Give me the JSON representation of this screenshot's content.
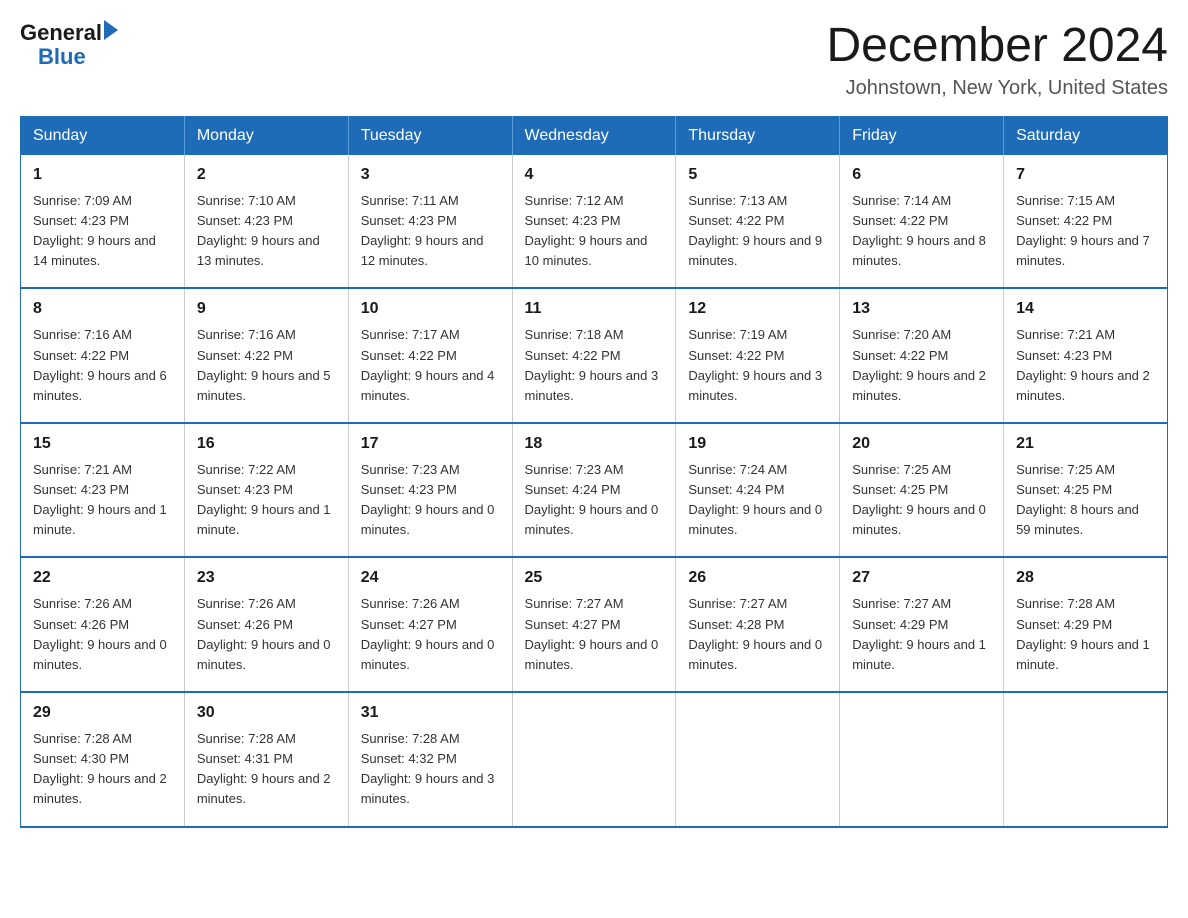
{
  "logo": {
    "general": "General",
    "blue": "Blue"
  },
  "title": "December 2024",
  "location": "Johnstown, New York, United States",
  "weekdays": [
    "Sunday",
    "Monday",
    "Tuesday",
    "Wednesday",
    "Thursday",
    "Friday",
    "Saturday"
  ],
  "weeks": [
    [
      {
        "day": "1",
        "sunrise": "Sunrise: 7:09 AM",
        "sunset": "Sunset: 4:23 PM",
        "daylight": "Daylight: 9 hours and 14 minutes."
      },
      {
        "day": "2",
        "sunrise": "Sunrise: 7:10 AM",
        "sunset": "Sunset: 4:23 PM",
        "daylight": "Daylight: 9 hours and 13 minutes."
      },
      {
        "day": "3",
        "sunrise": "Sunrise: 7:11 AM",
        "sunset": "Sunset: 4:23 PM",
        "daylight": "Daylight: 9 hours and 12 minutes."
      },
      {
        "day": "4",
        "sunrise": "Sunrise: 7:12 AM",
        "sunset": "Sunset: 4:23 PM",
        "daylight": "Daylight: 9 hours and 10 minutes."
      },
      {
        "day": "5",
        "sunrise": "Sunrise: 7:13 AM",
        "sunset": "Sunset: 4:22 PM",
        "daylight": "Daylight: 9 hours and 9 minutes."
      },
      {
        "day": "6",
        "sunrise": "Sunrise: 7:14 AM",
        "sunset": "Sunset: 4:22 PM",
        "daylight": "Daylight: 9 hours and 8 minutes."
      },
      {
        "day": "7",
        "sunrise": "Sunrise: 7:15 AM",
        "sunset": "Sunset: 4:22 PM",
        "daylight": "Daylight: 9 hours and 7 minutes."
      }
    ],
    [
      {
        "day": "8",
        "sunrise": "Sunrise: 7:16 AM",
        "sunset": "Sunset: 4:22 PM",
        "daylight": "Daylight: 9 hours and 6 minutes."
      },
      {
        "day": "9",
        "sunrise": "Sunrise: 7:16 AM",
        "sunset": "Sunset: 4:22 PM",
        "daylight": "Daylight: 9 hours and 5 minutes."
      },
      {
        "day": "10",
        "sunrise": "Sunrise: 7:17 AM",
        "sunset": "Sunset: 4:22 PM",
        "daylight": "Daylight: 9 hours and 4 minutes."
      },
      {
        "day": "11",
        "sunrise": "Sunrise: 7:18 AM",
        "sunset": "Sunset: 4:22 PM",
        "daylight": "Daylight: 9 hours and 3 minutes."
      },
      {
        "day": "12",
        "sunrise": "Sunrise: 7:19 AM",
        "sunset": "Sunset: 4:22 PM",
        "daylight": "Daylight: 9 hours and 3 minutes."
      },
      {
        "day": "13",
        "sunrise": "Sunrise: 7:20 AM",
        "sunset": "Sunset: 4:22 PM",
        "daylight": "Daylight: 9 hours and 2 minutes."
      },
      {
        "day": "14",
        "sunrise": "Sunrise: 7:21 AM",
        "sunset": "Sunset: 4:23 PM",
        "daylight": "Daylight: 9 hours and 2 minutes."
      }
    ],
    [
      {
        "day": "15",
        "sunrise": "Sunrise: 7:21 AM",
        "sunset": "Sunset: 4:23 PM",
        "daylight": "Daylight: 9 hours and 1 minute."
      },
      {
        "day": "16",
        "sunrise": "Sunrise: 7:22 AM",
        "sunset": "Sunset: 4:23 PM",
        "daylight": "Daylight: 9 hours and 1 minute."
      },
      {
        "day": "17",
        "sunrise": "Sunrise: 7:23 AM",
        "sunset": "Sunset: 4:23 PM",
        "daylight": "Daylight: 9 hours and 0 minutes."
      },
      {
        "day": "18",
        "sunrise": "Sunrise: 7:23 AM",
        "sunset": "Sunset: 4:24 PM",
        "daylight": "Daylight: 9 hours and 0 minutes."
      },
      {
        "day": "19",
        "sunrise": "Sunrise: 7:24 AM",
        "sunset": "Sunset: 4:24 PM",
        "daylight": "Daylight: 9 hours and 0 minutes."
      },
      {
        "day": "20",
        "sunrise": "Sunrise: 7:25 AM",
        "sunset": "Sunset: 4:25 PM",
        "daylight": "Daylight: 9 hours and 0 minutes."
      },
      {
        "day": "21",
        "sunrise": "Sunrise: 7:25 AM",
        "sunset": "Sunset: 4:25 PM",
        "daylight": "Daylight: 8 hours and 59 minutes."
      }
    ],
    [
      {
        "day": "22",
        "sunrise": "Sunrise: 7:26 AM",
        "sunset": "Sunset: 4:26 PM",
        "daylight": "Daylight: 9 hours and 0 minutes."
      },
      {
        "day": "23",
        "sunrise": "Sunrise: 7:26 AM",
        "sunset": "Sunset: 4:26 PM",
        "daylight": "Daylight: 9 hours and 0 minutes."
      },
      {
        "day": "24",
        "sunrise": "Sunrise: 7:26 AM",
        "sunset": "Sunset: 4:27 PM",
        "daylight": "Daylight: 9 hours and 0 minutes."
      },
      {
        "day": "25",
        "sunrise": "Sunrise: 7:27 AM",
        "sunset": "Sunset: 4:27 PM",
        "daylight": "Daylight: 9 hours and 0 minutes."
      },
      {
        "day": "26",
        "sunrise": "Sunrise: 7:27 AM",
        "sunset": "Sunset: 4:28 PM",
        "daylight": "Daylight: 9 hours and 0 minutes."
      },
      {
        "day": "27",
        "sunrise": "Sunrise: 7:27 AM",
        "sunset": "Sunset: 4:29 PM",
        "daylight": "Daylight: 9 hours and 1 minute."
      },
      {
        "day": "28",
        "sunrise": "Sunrise: 7:28 AM",
        "sunset": "Sunset: 4:29 PM",
        "daylight": "Daylight: 9 hours and 1 minute."
      }
    ],
    [
      {
        "day": "29",
        "sunrise": "Sunrise: 7:28 AM",
        "sunset": "Sunset: 4:30 PM",
        "daylight": "Daylight: 9 hours and 2 minutes."
      },
      {
        "day": "30",
        "sunrise": "Sunrise: 7:28 AM",
        "sunset": "Sunset: 4:31 PM",
        "daylight": "Daylight: 9 hours and 2 minutes."
      },
      {
        "day": "31",
        "sunrise": "Sunrise: 7:28 AM",
        "sunset": "Sunset: 4:32 PM",
        "daylight": "Daylight: 9 hours and 3 minutes."
      },
      null,
      null,
      null,
      null
    ]
  ]
}
